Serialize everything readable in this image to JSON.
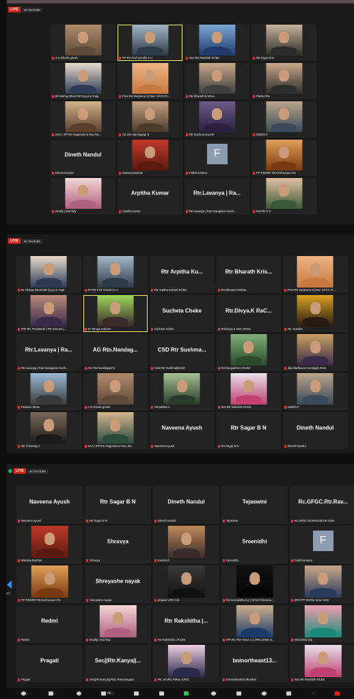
{
  "live": {
    "badge": "LIVE",
    "platform": "on YouTube"
  },
  "grid1": {
    "tiles": [
      {
        "label": "A.K.Ghosh ghosh",
        "name": "",
        "c1": "#b08b6a",
        "c2": "#5e4a3a"
      },
      {
        "label": "PP Rtr Prof Srinidhi S U",
        "name": "",
        "c1": "#a3b7c7",
        "c2": "#2e3a47",
        "active": true
      },
      {
        "label": "Sec Rtr Rakshith RCBS",
        "name": "",
        "c1": "#7aa7d6",
        "c2": "#1f3a6b"
      },
      {
        "label": "Rtr Sagar B N",
        "name": "",
        "c1": "#c9b49e",
        "c2": "#2b2b2b"
      },
      {
        "label": "Dr Akshay Bhoir MD (Ayu) & Yoga",
        "name": "",
        "c1": "#e6dccc",
        "c2": "#2f3a55"
      },
      {
        "label": "Pres Rtr Meghana S| RaC GFGC R...",
        "name": "",
        "c1": "#f0b585",
        "c2": "#c6793f"
      },
      {
        "label": "Rtr Bharath Krishna",
        "name": "",
        "c1": "#c8a88a",
        "c2": "#3e3e3e"
      },
      {
        "label": "Parker Rte",
        "name": "",
        "c1": "#c8a88a",
        "c2": "#2d2d2d"
      },
      {
        "label": "SAA | IPP Rtr Nagendra E Rac Ra...",
        "name": "",
        "c1": "#d2b48c",
        "c2": "#593c2a"
      },
      {
        "label": "AG Rtn.Nandagopi N",
        "name": "",
        "c1": "#c4a080",
        "c2": "#4a3b2c"
      },
      {
        "label": "Rtr Sushma Suresh",
        "name": "",
        "c1": "#6d5a8a",
        "c2": "#2c2040"
      },
      {
        "label": "Nishith P",
        "name": "",
        "c1": "#b9a589",
        "c2": "#3a4a5a"
      },
      {
        "label": "Dineth Nandul",
        "name": "Dineth Nandul"
      },
      {
        "label": "Manasa Bushan",
        "name": "",
        "c1": "#c0392b",
        "c2": "#5a1a10"
      },
      {
        "label": "Fathima Bano",
        "name": "",
        "letter": "F"
      },
      {
        "label": "PP PDDRR Rtr.Krishnarjun CN",
        "name": "",
        "c1": "#e0a05a",
        "c2": "#7a3a10"
      },
      {
        "label": "Onally | Mid City",
        "name": "",
        "c1": "#f4d6d6",
        "c2": "#b06080"
      },
      {
        "label": "Arpitha Kumar",
        "name": "Arpitha Kumar"
      },
      {
        "label": "Rtr.Lavanya | RaC Bangalore Sesh...",
        "name": "Rtr.Lavanya | Ra..."
      },
      {
        "label": "Keerthi R K",
        "name": "",
        "c1": "#e0c0a0",
        "c2": "#3a5a3a"
      }
    ]
  },
  "grid2": {
    "tiles": [
      {
        "label": "Dr Akshay Bhoir MD (Ayu) & Yoga",
        "name": "",
        "c1": "#e6dccc",
        "c2": "#2f3a55"
      },
      {
        "label": "PP Rtr Prof Srinidhi S U",
        "name": "",
        "c1": "#a3b7c7",
        "c2": "#2e3a47"
      },
      {
        "label": "Rtr Arpitha Kumar| RCBS",
        "name": "Rtr Arpitha Ku..."
      },
      {
        "label": "Rtr Bharath Krishna",
        "name": "Rtr Bharath Kris..."
      },
      {
        "label": "Pres Rtr Meghana S| RaC GFGC R...",
        "name": "",
        "c1": "#f0b585",
        "c2": "#c6793f"
      },
      {
        "label": "IPP, Rtr. Prashanth | PR Director |...",
        "name": "",
        "c1": "#b98a7a",
        "c2": "#3a2a4a"
      },
      {
        "label": "Dr Tanuja Gobane",
        "name": "",
        "c1": "#9ed85a",
        "c2": "#3a2a2a",
        "hl": true
      },
      {
        "label": "Sucheta Cheke",
        "name": "Sucheta Cheke"
      },
      {
        "label": "Rtr.Divya.K RaC GFGC",
        "name": "Rtr.Divya.K RaC..."
      },
      {
        "label": "Rtr. Sunidhi",
        "name": "",
        "c1": "#d9a020",
        "c2": "#2a1a10"
      },
      {
        "label": "Rtr.Lavanya | RaC Bangalore Sesh...",
        "name": "Rtr.Lavanya | Ra..."
      },
      {
        "label": "AG Rtn.Nandagopi N",
        "name": "AG Rtn.Nandag..."
      },
      {
        "label": "CSD Rtr Sushma|RCBS",
        "name": "CSD Rtr Sushma..."
      },
      {
        "label": "Rtr Navyashree| RCBS",
        "name": "",
        "c1": "#7fb07a",
        "c2": "#2a4a2a"
      },
      {
        "label": "Jija Madhavan Hansjagh RCB",
        "name": "",
        "c1": "#c9a060",
        "c2": "#3a2a4a"
      },
      {
        "label": "Praveen Mone",
        "name": "",
        "c1": "#9ab8d8",
        "c2": "#3a3a3a"
      },
      {
        "label": "A.K.Ghosh ghosh",
        "name": "",
        "c1": "#b08b6a",
        "c2": "#5e4a3a"
      },
      {
        "label": "Shraddha H",
        "name": "",
        "c1": "#a8c090",
        "c2": "#2a3a2a"
      },
      {
        "label": "Sec Rtr Rakshith RCBS",
        "name": "",
        "c1": "#e8e0e8",
        "c2": "#c04070"
      },
      {
        "label": "Nishith P",
        "name": "",
        "c1": "#b9a589",
        "c2": "#3a4a5a"
      },
      {
        "label": "Rtr Thanmay s",
        "name": "",
        "c1": "#7a6a5a",
        "c2": "#1a1a1a"
      },
      {
        "label": "SAA | IPP Rtr Nagendra E Rac Ra...",
        "name": "",
        "c1": "#d2b48c",
        "c2": "#2a4a3a"
      },
      {
        "label": "Naveena Ayush",
        "name": "Naveena Ayush"
      },
      {
        "label": "Rtr Sagar B N",
        "name": "Rtr Sagar B N"
      },
      {
        "label": "Dineth Nandul",
        "name": "Dineth Nandul"
      }
    ]
  },
  "grid3": {
    "tiles": [
      {
        "label": "Naveena Ayush",
        "name": "Naveena Ayush"
      },
      {
        "label": "Rtr Sagar B N",
        "name": "Rtr Sagar B N"
      },
      {
        "label": "Dineth Nandul",
        "name": "Dineth Nandul"
      },
      {
        "label": "Tejaswini",
        "name": "Tejaswini"
      },
      {
        "label": "Rc.GFGC.Rtr.Ravindra M 3190",
        "name": "Rc.GFGC.Rtr.Rav..."
      },
      {
        "label": "Manasa Bushan",
        "name": "",
        "c1": "#c0392b",
        "c2": "#5a1a10"
      },
      {
        "label": "Shravya",
        "name": "Shravya"
      },
      {
        "label": "Kushal R",
        "name": "",
        "c1": "#c08a5a",
        "c2": "#3a2a2a"
      },
      {
        "label": "Sreenidhi",
        "name": "Sreenidhi"
      },
      {
        "label": "Fathima Bano",
        "name": "",
        "letter": "F"
      },
      {
        "label": "PP PDDRR Rtr.Krishnarjun CN",
        "name": "",
        "c1": "#e0a05a",
        "c2": "#7a3a10"
      },
      {
        "label": "Shreyashe nayak",
        "name": "Shreyashe nayak"
      },
      {
        "label": "prajwal UPR 136",
        "name": "",
        "c1": "#3a3a3a",
        "c2": "#101010"
      },
      {
        "label": "Rtr.Hemalatha.k.g | GFGC Ramana...",
        "name": "",
        "c1": "#121212",
        "c2": "#050505"
      },
      {
        "label": "ZRR PP Rtr.Rtn Kiran SHS",
        "name": "",
        "c1": "#c8a888",
        "c2": "#2a3a5a"
      },
      {
        "label": "Redmi",
        "name": "Redmi"
      },
      {
        "label": "Onally | Mid City",
        "name": "",
        "c1": "#f4d6d6",
        "c2": "#b06080"
      },
      {
        "label": "Rtr Rakshitha | RCBS",
        "name": "Rtr Rakshitha |..."
      },
      {
        "label": "IPP Rtr /Rtn Tarun U | ZRR ZONE G...",
        "name": "",
        "c1": "#d0b090",
        "c2": "#1a3a6a"
      },
      {
        "label": "Ishini-Mid City",
        "name": "",
        "c1": "#f0a0b0",
        "c2": "#1a8a7a"
      },
      {
        "label": "Pragati",
        "name": "Pragati"
      },
      {
        "label": "Sec||Rtr.Kanya|| RaC Ramanagara",
        "name": "Sec||Rtr.Kanya||..."
      },
      {
        "label": "Rtr. Sindhu P|Rac GFGC",
        "name": "",
        "c1": "#f0d0e0",
        "c2": "#2a2a4a"
      },
      {
        "label": "bninortheast13 Mumbai",
        "name": "bninortheast13..."
      },
      {
        "label": "Sec Rtr Rakshith RCBS",
        "name": "",
        "c1": "#e8e0e8",
        "c2": "#c04070"
      }
    ]
  },
  "pager": {
    "page": "2/2"
  },
  "toolbar": {
    "participants_count": "46",
    "items": [
      "mic",
      "video",
      "security",
      "participants",
      "chat",
      "polls",
      "share",
      "record",
      "apps",
      "reactions",
      "whiteboard",
      "more",
      "leave"
    ]
  }
}
